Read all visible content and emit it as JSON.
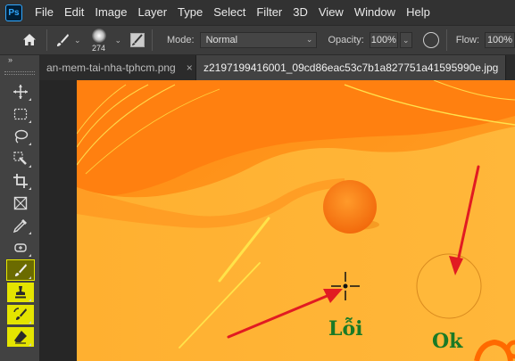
{
  "app": {
    "logo_text": "Ps"
  },
  "menu": [
    "File",
    "Edit",
    "Image",
    "Layer",
    "Type",
    "Select",
    "Filter",
    "3D",
    "View",
    "Window",
    "Help"
  ],
  "options": {
    "brush_size": "274",
    "mode_label": "Mode:",
    "mode_value": "Normal",
    "opacity_label": "Opacity:",
    "opacity_value": "100%",
    "flow_label": "Flow:",
    "flow_value": "100%"
  },
  "tabs": [
    {
      "label": "an-mem-tai-nha-tphcm.png",
      "close": "×",
      "active": false
    },
    {
      "label": "z2197199416001_09cd86eac53c7b1a827751a41595990e.jpg",
      "close": "×",
      "active": true
    }
  ],
  "toolbar": {
    "collapse": "»",
    "tools": [
      "move-tool",
      "marquee-tool",
      "lasso-tool",
      "quick-select-tool",
      "crop-tool",
      "frame-tool",
      "eyedropper-tool",
      "spot-healing-tool",
      "brush-tool",
      "clone-stamp-tool",
      "history-brush-tool",
      "eraser-tool"
    ]
  },
  "annotations": {
    "error_label": "Lỗi",
    "ok_label": "Ok"
  },
  "colors": {
    "canvas_orange": "#ff9a1a",
    "accent_yellow": "#ffd21f",
    "annotation_red": "#e11b22",
    "label_green": "#1a7a26"
  }
}
